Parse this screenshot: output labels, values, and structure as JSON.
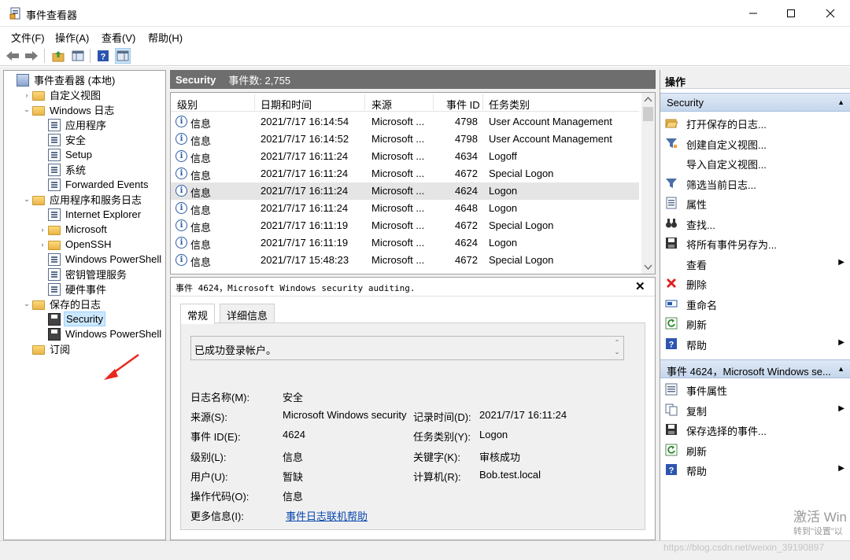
{
  "window": {
    "title": "事件查看器"
  },
  "menu": [
    "文件(F)",
    "操作(A)",
    "查看(V)",
    "帮助(H)"
  ],
  "tree": [
    {
      "label": "事件查看器 (本地)",
      "level": 0,
      "expander": "",
      "icon": "event-viewer-icon",
      "selected": false
    },
    {
      "label": "自定义视图",
      "level": 1,
      "expander": ">",
      "icon": "folder-icon",
      "selected": false
    },
    {
      "label": "Windows 日志",
      "level": 1,
      "expander": "v",
      "icon": "folder-icon",
      "selected": false
    },
    {
      "label": "应用程序",
      "level": 2,
      "expander": "",
      "icon": "log-icon",
      "selected": false
    },
    {
      "label": "安全",
      "level": 2,
      "expander": "",
      "icon": "log-icon",
      "selected": false
    },
    {
      "label": "Setup",
      "level": 2,
      "expander": "",
      "icon": "log-icon",
      "selected": false
    },
    {
      "label": "系统",
      "level": 2,
      "expander": "",
      "icon": "log-icon",
      "selected": false
    },
    {
      "label": "Forwarded Events",
      "level": 2,
      "expander": "",
      "icon": "log-icon",
      "selected": false
    },
    {
      "label": "应用程序和服务日志",
      "level": 1,
      "expander": "v",
      "icon": "folder-icon",
      "selected": false
    },
    {
      "label": "Internet Explorer",
      "level": 2,
      "expander": "",
      "icon": "log-icon",
      "selected": false
    },
    {
      "label": "Microsoft",
      "level": 2,
      "expander": ">",
      "icon": "folder-icon",
      "selected": false
    },
    {
      "label": "OpenSSH",
      "level": 2,
      "expander": ">",
      "icon": "folder-icon",
      "selected": false
    },
    {
      "label": "Windows PowerShell",
      "level": 2,
      "expander": "",
      "icon": "log-icon",
      "selected": false
    },
    {
      "label": "密钥管理服务",
      "level": 2,
      "expander": "",
      "icon": "log-icon",
      "selected": false
    },
    {
      "label": "硬件事件",
      "level": 2,
      "expander": "",
      "icon": "log-icon",
      "selected": false
    },
    {
      "label": "保存的日志",
      "level": 1,
      "expander": "v",
      "icon": "folder-icon",
      "selected": false
    },
    {
      "label": "Security",
      "level": 2,
      "expander": "",
      "icon": "saved-log-icon",
      "selected": true
    },
    {
      "label": "Windows PowerShell",
      "level": 2,
      "expander": "",
      "icon": "saved-log-icon",
      "selected": false
    },
    {
      "label": "订阅",
      "level": 1,
      "expander": "",
      "icon": "subscription-icon",
      "selected": false
    }
  ],
  "center": {
    "log_name": "Security",
    "event_count": "事件数: 2,755"
  },
  "columns": [
    "级别",
    "日期和时间",
    "来源",
    "事件 ID",
    "任务类别"
  ],
  "events": [
    {
      "level": "信息",
      "datetime": "2021/7/17 16:14:54",
      "source": "Microsoft ...",
      "id": "4798",
      "task": "User Account Management",
      "selected": false
    },
    {
      "level": "信息",
      "datetime": "2021/7/17 16:14:52",
      "source": "Microsoft ...",
      "id": "4798",
      "task": "User Account Management",
      "selected": false
    },
    {
      "level": "信息",
      "datetime": "2021/7/17 16:11:24",
      "source": "Microsoft ...",
      "id": "4634",
      "task": "Logoff",
      "selected": false
    },
    {
      "level": "信息",
      "datetime": "2021/7/17 16:11:24",
      "source": "Microsoft ...",
      "id": "4672",
      "task": "Special Logon",
      "selected": false
    },
    {
      "level": "信息",
      "datetime": "2021/7/17 16:11:24",
      "source": "Microsoft ...",
      "id": "4624",
      "task": "Logon",
      "selected": true
    },
    {
      "level": "信息",
      "datetime": "2021/7/17 16:11:24",
      "source": "Microsoft ...",
      "id": "4648",
      "task": "Logon",
      "selected": false
    },
    {
      "level": "信息",
      "datetime": "2021/7/17 16:11:19",
      "source": "Microsoft ...",
      "id": "4672",
      "task": "Special Logon",
      "selected": false
    },
    {
      "level": "信息",
      "datetime": "2021/7/17 16:11:19",
      "source": "Microsoft ...",
      "id": "4624",
      "task": "Logon",
      "selected": false
    },
    {
      "level": "信息",
      "datetime": "2021/7/17 15:48:23",
      "source": "Microsoft ...",
      "id": "4672",
      "task": "Special Logon",
      "selected": false
    }
  ],
  "detail": {
    "header": "事件 4624，Microsoft Windows security auditing.",
    "tabs": [
      "常规",
      "详细信息"
    ],
    "message": "已成功登录帐户。",
    "labels": {
      "log_name": "日志名称(M):",
      "source": "来源(S):",
      "event_id": "事件 ID(E):",
      "level": "级别(L):",
      "user": "用户(U):",
      "opcode": "操作代码(O):",
      "more_info": "更多信息(I):",
      "logged": "记录时间(D):",
      "task": "任务类别(Y):",
      "keywords": "关键字(K):",
      "computer": "计算机(R):"
    },
    "values": {
      "log_name": "安全",
      "source": "Microsoft Windows security",
      "event_id": "4624",
      "level": "信息",
      "user": "暂缺",
      "opcode": "信息",
      "more_info_link": "事件日志联机帮助",
      "logged": "2021/7/17 16:11:24",
      "task": "Logon",
      "keywords": "审核成功",
      "computer": "Bob.test.local"
    }
  },
  "actions": {
    "header": "操作",
    "section1": "Security",
    "section1_items": [
      {
        "label": "打开保存的日志...",
        "icon": "open-folder-icon",
        "submenu": false
      },
      {
        "label": "创建自定义视图...",
        "icon": "filter-create-icon",
        "submenu": false
      },
      {
        "label": "导入自定义视图...",
        "icon": "",
        "submenu": false
      },
      {
        "label": "筛选当前日志...",
        "icon": "filter-icon",
        "submenu": false
      },
      {
        "label": "属性",
        "icon": "properties-icon",
        "submenu": false
      },
      {
        "label": "查找...",
        "icon": "binoculars-icon",
        "submenu": false
      },
      {
        "label": "将所有事件另存为...",
        "icon": "save-icon",
        "submenu": false
      },
      {
        "label": "查看",
        "icon": "",
        "submenu": true
      },
      {
        "label": "删除",
        "icon": "delete-icon",
        "submenu": false
      },
      {
        "label": "重命名",
        "icon": "rename-icon",
        "submenu": false
      },
      {
        "label": "刷新",
        "icon": "refresh-icon",
        "submenu": false
      },
      {
        "label": "帮助",
        "icon": "help-icon",
        "submenu": true
      }
    ],
    "section2": "事件 4624，Microsoft Windows se...",
    "section2_items": [
      {
        "label": "事件属性",
        "icon": "event-properties-icon",
        "submenu": false
      },
      {
        "label": "复制",
        "icon": "copy-icon",
        "submenu": true
      },
      {
        "label": "保存选择的事件...",
        "icon": "save-icon",
        "submenu": false
      },
      {
        "label": "刷新",
        "icon": "refresh-icon",
        "submenu": false
      },
      {
        "label": "帮助",
        "icon": "help-icon",
        "submenu": true
      }
    ]
  },
  "watermark": {
    "activate_line1": "激活 Win",
    "activate_line2": "转到\"设置\"以",
    "url": "https://blog.csdn.net/weixin_39190897"
  }
}
